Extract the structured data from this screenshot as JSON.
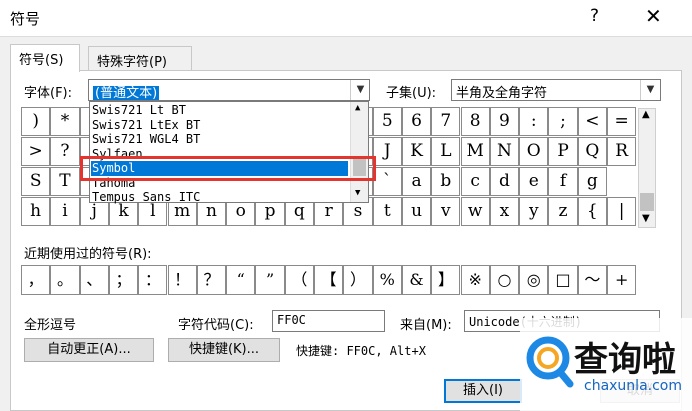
{
  "window": {
    "title": "符号",
    "help_label": "?",
    "close_label": "✕"
  },
  "tabs": [
    {
      "label": "符号(S)",
      "active": true
    },
    {
      "label": "特殊字符(P)",
      "active": false
    }
  ],
  "font": {
    "label": "字体(F):",
    "value": "(普通文本)"
  },
  "subset": {
    "label": "子集(U):",
    "value": "半角及全角字符"
  },
  "font_dropdown": {
    "items": [
      "Swis721 Lt BT",
      "Swis721 LtEx BT",
      "Swis721 WGL4 BT",
      "Sylfaen",
      "Symbol",
      "Tahoma",
      "Tempus Sans ITC"
    ],
    "selected": "Symbol"
  },
  "symbol_grid": {
    "rows": [
      [
        ")",
        "*",
        "",
        "",
        "",
        "",
        "",
        "",
        "",
        "",
        "",
        "",
        "5",
        "6",
        "7",
        "8",
        "9",
        ":",
        ";",
        "<",
        "="
      ],
      [
        ">",
        "?",
        "",
        "",
        "",
        "",
        "",
        "",
        "",
        "",
        "",
        "",
        "J",
        "K",
        "L",
        "M",
        "N",
        "O",
        "P",
        "Q",
        "R"
      ],
      [
        "S",
        "T",
        "",
        "",
        "",
        "",
        "",
        "",
        "",
        "",
        "",
        "",
        "`",
        "a",
        "b",
        "c",
        "d",
        "e",
        "f",
        "g"
      ],
      [
        "h",
        "i",
        "j",
        "k",
        "l",
        "m",
        "n",
        "o",
        "p",
        "q",
        "r",
        "s",
        "t",
        "u",
        "v",
        "w",
        "x",
        "y",
        "z",
        "{",
        "|"
      ]
    ]
  },
  "recent": {
    "label": "近期使用过的符号(R):",
    "symbols": [
      "，",
      "。",
      "、",
      "；",
      "：",
      "！",
      "？",
      "“",
      "”",
      "（",
      "【",
      "）",
      "%",
      "&",
      "】",
      "※",
      "○",
      "◎",
      "□",
      "～",
      "+"
    ]
  },
  "char_name": "全形逗号",
  "char_code": {
    "label": "字符代码(C):",
    "value": "FF0C"
  },
  "from": {
    "label": "来自(M):",
    "value": "Unicode(十六进制)"
  },
  "buttons": {
    "autocorrect": "自动更正(A)...",
    "shortcut": "快捷键(K)...",
    "shortcut_text": "快捷键: FF0C, Alt+X",
    "insert": "插入(I)",
    "cancel": "取消"
  },
  "watermark": {
    "text": "查询啦",
    "url": "chaxunla.com"
  },
  "colors": {
    "selection": "#0078d7",
    "highlight_box": "#e5342e",
    "watermark_blue": "#1e88e5"
  }
}
